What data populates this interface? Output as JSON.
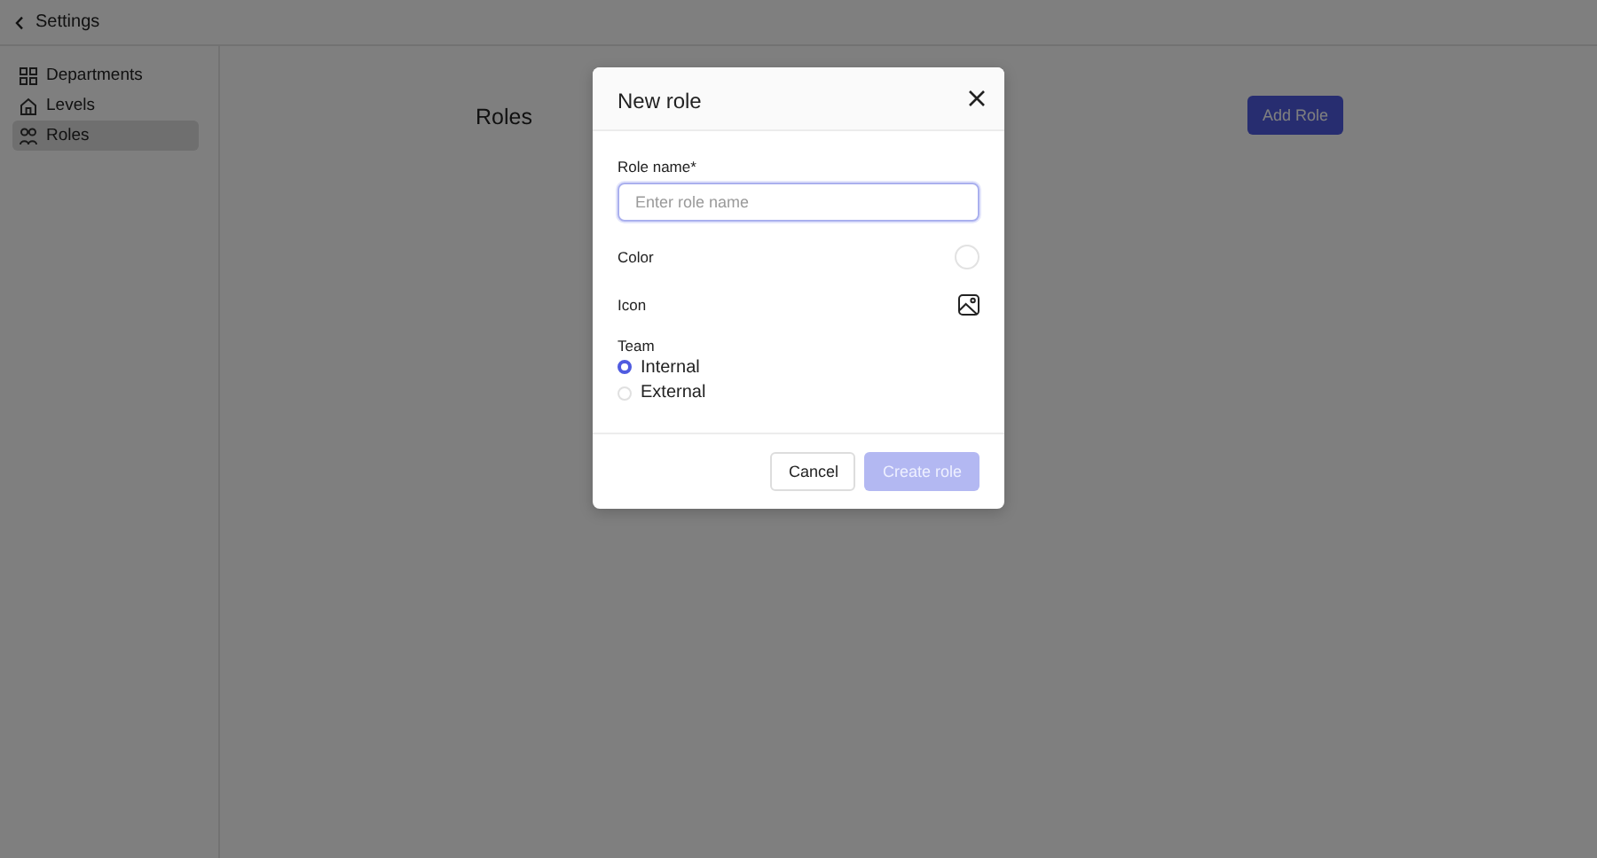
{
  "header": {
    "back_label": "Settings"
  },
  "sidebar": {
    "items": [
      {
        "label": "Departments",
        "selected": false
      },
      {
        "label": "Levels",
        "selected": false
      },
      {
        "label": "Roles",
        "selected": true
      }
    ]
  },
  "main": {
    "title": "Roles",
    "add_button": "Add Role"
  },
  "dialog": {
    "title": "New role",
    "fields": [
      {
        "kind": "text",
        "label": "Role name*",
        "placeholder": "Enter role name"
      },
      {
        "kind": "color",
        "label": "Color"
      },
      {
        "kind": "icon",
        "label": "Icon"
      },
      {
        "kind": "radio",
        "label": "Team",
        "options": [
          {
            "label": "Internal",
            "selected": true
          },
          {
            "label": "External",
            "selected": false
          }
        ]
      }
    ],
    "buttons": [
      {
        "kind": "secondary",
        "label": "Cancel",
        "disabled": false
      },
      {
        "kind": "primary",
        "label": "Create role",
        "disabled": true
      }
    ]
  }
}
